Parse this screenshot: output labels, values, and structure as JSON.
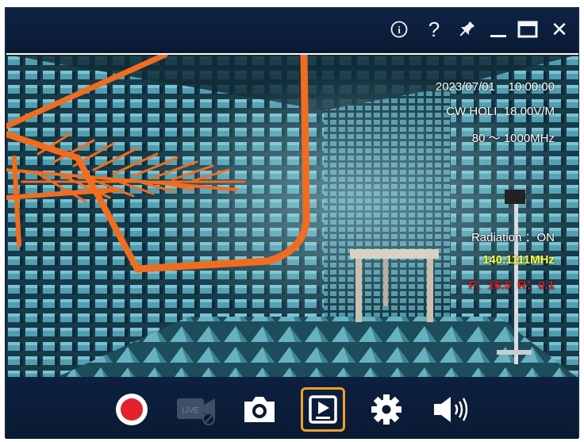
{
  "titlebar": {
    "controls": [
      {
        "name": "info-icon"
      },
      {
        "name": "help-icon"
      },
      {
        "name": "pin-icon"
      },
      {
        "name": "minimize-icon"
      },
      {
        "name": "maximize-icon"
      },
      {
        "name": "close-icon"
      }
    ],
    "help_glyph": "?",
    "close_glyph": "✕",
    "info_glyph": "i"
  },
  "overlay": {
    "date": "2023/07/01",
    "time": "10:00:00",
    "mode": "CW HOLI",
    "field_strength": "18.00V/M",
    "freq_range": "80 ～ 1000MHz",
    "radiation": "Radiation ：ON",
    "current_freq": "140.1111MHz",
    "angle_readout": "F：16.5  R：0.1"
  },
  "toolbar": {
    "live_label": "LIVE",
    "active_tool": "playback-button",
    "colors": {
      "record": "#e5212b",
      "active_border": "#f0a21f",
      "live_disabled": "#3e5066",
      "icon": "#ffffff"
    }
  },
  "colors": {
    "background": "#0b1a33",
    "overlay_freq": "#ffff33",
    "overlay_angle": "#e4141c"
  }
}
